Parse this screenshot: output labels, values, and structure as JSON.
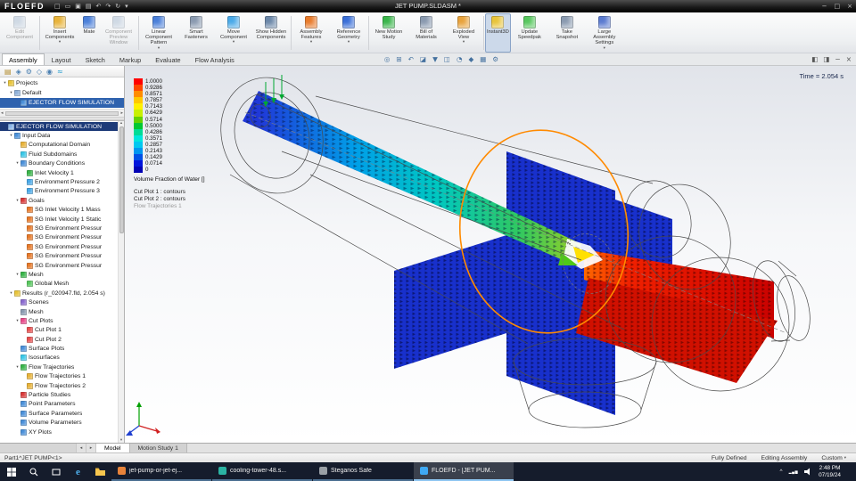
{
  "colors": {
    "accent": "#2f7bd9",
    "legend": [
      "#ff0000",
      "#ff4800",
      "#ff8c00",
      "#ffc800",
      "#fff000",
      "#c8f000",
      "#64d200",
      "#00c832",
      "#00dc96",
      "#00e6dc",
      "#00c8f0",
      "#0096f0",
      "#0050e6",
      "#0014dc",
      "#0000b4"
    ]
  },
  "glyphs": {
    "left": "◂",
    "right": "▸",
    "up": "▴",
    "down": "▾",
    "caret": "▾",
    "chevron_up": "^"
  },
  "titlebar": {
    "logo": "FLOEFD",
    "title": "JET PUMP.SLDASM *",
    "qat": [
      {
        "name": "new-document-icon",
        "glyph": "□"
      },
      {
        "name": "open-icon",
        "glyph": "▭"
      },
      {
        "name": "save-icon",
        "glyph": "▣"
      },
      {
        "name": "print-icon",
        "glyph": "▤"
      },
      {
        "name": "undo-icon",
        "glyph": "↶"
      },
      {
        "name": "redo-icon",
        "glyph": "↷"
      },
      {
        "name": "rebuild-icon",
        "glyph": "↻"
      },
      {
        "name": "options-dropdown-icon",
        "glyph": "▾"
      }
    ],
    "window_controls": [
      {
        "name": "minimize-button",
        "glyph": "−"
      },
      {
        "name": "restore-button",
        "glyph": "□"
      },
      {
        "name": "close-button",
        "glyph": "×"
      }
    ]
  },
  "ribbon": {
    "buttons": [
      {
        "label": "Edit Component",
        "disabled": true,
        "icon_color": "#9fb4cc",
        "group_end": true
      },
      {
        "label": "Insert Components",
        "dropdown": true,
        "icon_color": "#e8b33a"
      },
      {
        "label": "Mate",
        "icon_color": "#4a7fd9"
      },
      {
        "label": "Component Preview Window",
        "disabled": true,
        "icon_color": "#9fb4cc",
        "group_end": true
      },
      {
        "label": "Linear Component Pattern",
        "dropdown": true,
        "icon_color": "#4a7fd9"
      },
      {
        "label": "Smart Fasteners",
        "icon_color": "#8a9ab0"
      },
      {
        "label": "Move Component",
        "dropdown": true,
        "icon_color": "#49a9e8"
      },
      {
        "label": "Show Hidden Components",
        "icon_color": "#6b87a8",
        "group_end": true
      },
      {
        "label": "Assembly Features",
        "dropdown": true,
        "icon_color": "#e87a2a"
      },
      {
        "label": "Reference Geometry",
        "dropdown": true,
        "icon_color": "#3a6fd8",
        "group_end": true
      },
      {
        "label": "New Motion Study",
        "icon_color": "#39b54a"
      },
      {
        "label": "Bill of Materials",
        "icon_color": "#8a9ab0"
      },
      {
        "label": "Exploded View",
        "dropdown": true,
        "icon_color": "#e8a23a",
        "group_end": true
      },
      {
        "label": "Instant3D",
        "active": true,
        "icon_color": "#e8c43a"
      },
      {
        "label": "Update Speedpak",
        "icon_color": "#57c75e"
      },
      {
        "label": "Take Snapshot",
        "icon_color": "#8a9ab0"
      },
      {
        "label": "Large Assembly Settings",
        "dropdown": true,
        "icon_color": "#5a7ad0"
      }
    ]
  },
  "tabs": [
    {
      "label": "Assembly",
      "active": true
    },
    {
      "label": "Layout"
    },
    {
      "label": "Sketch"
    },
    {
      "label": "Markup"
    },
    {
      "label": "Evaluate"
    },
    {
      "label": "Flow Analysis"
    }
  ],
  "headsup": [
    {
      "name": "zoom-fit-icon",
      "glyph": "◎"
    },
    {
      "name": "zoom-area-icon",
      "glyph": "⊞"
    },
    {
      "name": "previous-view-icon",
      "glyph": "↶"
    },
    {
      "name": "section-view-icon",
      "glyph": "◪"
    },
    {
      "name": "view-orientation-icon",
      "glyph": "▼"
    },
    {
      "name": "display-style-icon",
      "glyph": "◫"
    },
    {
      "name": "hide-show-items-icon",
      "glyph": "◔"
    },
    {
      "name": "edit-appearance-icon",
      "glyph": "◆"
    },
    {
      "name": "apply-scene-icon",
      "glyph": "▦"
    },
    {
      "name": "view-settings-icon",
      "glyph": "⚙"
    }
  ],
  "viewport_controls": [
    {
      "name": "toggle-left-pane-icon",
      "glyph": "◧"
    },
    {
      "name": "toggle-right-pane-icon",
      "glyph": "◨"
    },
    {
      "name": "minimize-view-icon",
      "glyph": "−"
    },
    {
      "name": "close-view-icon",
      "glyph": "×"
    }
  ],
  "panel_tabs": [
    {
      "name": "feature-manager-tab",
      "glyph": "▤",
      "color": "#b08828"
    },
    {
      "name": "property-manager-tab",
      "glyph": "◈",
      "color": "#4a7fb0"
    },
    {
      "name": "configuration-manager-tab",
      "glyph": "⚙",
      "color": "#4a7fb0"
    },
    {
      "name": "dimxpert-tab",
      "glyph": "◇",
      "color": "#4a7fb0"
    },
    {
      "name": "display-manager-tab",
      "glyph": "◉",
      "color": "#4a7fb0"
    },
    {
      "name": "flow-simulation-tab",
      "glyph": "≈",
      "color": "#2a9fd0"
    }
  ],
  "project_tree": [
    {
      "label": "Projects",
      "indent": 0,
      "expander": "▾",
      "color": "#e8c43a"
    },
    {
      "label": "Default",
      "indent": 1,
      "expander": "▾",
      "color": "#8fb0d8"
    },
    {
      "label": "EJECTOR FLOW SIMULATION",
      "indent": 2,
      "expander": "",
      "color": "#4a90d9",
      "selected": true
    }
  ],
  "sim_tree": [
    {
      "label": "EJECTOR FLOW SIMULATION",
      "indent": 0,
      "expander": "",
      "color": "#8ab4e8",
      "selected": true
    },
    {
      "label": "Input Data",
      "indent": 1,
      "expander": "▾",
      "color": "#4a90d9"
    },
    {
      "label": "Computational Domain",
      "indent": 2,
      "expander": "",
      "color": "#e8b33a"
    },
    {
      "label": "Fluid Subdomains",
      "indent": 2,
      "expander": "",
      "color": "#39c8e8"
    },
    {
      "label": "Boundary Conditions",
      "indent": 2,
      "expander": "▾",
      "color": "#4a90d9"
    },
    {
      "label": "Inlet Velocity 1",
      "indent": 3,
      "expander": "",
      "color": "#39b54a"
    },
    {
      "label": "Environment Pressure 2",
      "indent": 3,
      "expander": "",
      "color": "#49a9e8"
    },
    {
      "label": "Environment Pressure 3",
      "indent": 3,
      "expander": "",
      "color": "#49a9e8"
    },
    {
      "label": "Goals",
      "indent": 2,
      "expander": "▾",
      "color": "#d93a3a"
    },
    {
      "label": "SG Inlet Velocity 1 Mass",
      "indent": 3,
      "expander": "",
      "color": "#e87a2a"
    },
    {
      "label": "SG Inlet Velocity 1 Static",
      "indent": 3,
      "expander": "",
      "color": "#e87a2a"
    },
    {
      "label": "SG Environment Pressur",
      "indent": 3,
      "expander": "",
      "color": "#e87a2a"
    },
    {
      "label": "SG Environment Pressur",
      "indent": 3,
      "expander": "",
      "color": "#e87a2a"
    },
    {
      "label": "SG Environment Pressur",
      "indent": 3,
      "expander": "",
      "color": "#e87a2a"
    },
    {
      "label": "SG Environment Pressur",
      "indent": 3,
      "expander": "",
      "color": "#e87a2a"
    },
    {
      "label": "SG Environment Pressur",
      "indent": 3,
      "expander": "",
      "color": "#e87a2a"
    },
    {
      "label": "Mesh",
      "indent": 2,
      "expander": "▾",
      "color": "#39b54a"
    },
    {
      "label": "Global Mesh",
      "indent": 3,
      "expander": "",
      "color": "#57c75e"
    },
    {
      "label": "Results (r_020947.fld, 2.054 s)",
      "indent": 1,
      "expander": "▾",
      "color": "#e8c43a"
    },
    {
      "label": "Scenes",
      "indent": 2,
      "expander": "",
      "color": "#8a6ad0"
    },
    {
      "label": "Mesh",
      "indent": 2,
      "expander": "",
      "color": "#8a9ab0"
    },
    {
      "label": "Cut Plots",
      "indent": 2,
      "expander": "▾",
      "color": "#e84a8a"
    },
    {
      "label": "Cut Plot 1",
      "indent": 3,
      "expander": "",
      "color": "#e85050"
    },
    {
      "label": "Cut Plot 2",
      "indent": 3,
      "expander": "",
      "color": "#e85050"
    },
    {
      "label": "Surface Plots",
      "indent": 2,
      "expander": "",
      "color": "#4a90d9"
    },
    {
      "label": "Isosurfaces",
      "indent": 2,
      "expander": "",
      "color": "#39c8e8"
    },
    {
      "label": "Flow Trajectories",
      "indent": 2,
      "expander": "▾",
      "color": "#39b54a"
    },
    {
      "label": "Flow Trajectories 1",
      "indent": 3,
      "expander": "",
      "color": "#e8b33a"
    },
    {
      "label": "Flow Trajectories 2",
      "indent": 3,
      "expander": "",
      "color": "#e8b33a"
    },
    {
      "label": "Particle Studies",
      "indent": 2,
      "expander": "",
      "color": "#d93a3a"
    },
    {
      "label": "Point Parameters",
      "indent": 2,
      "expander": "",
      "color": "#4a90d9"
    },
    {
      "label": "Surface Parameters",
      "indent": 2,
      "expander": "",
      "color": "#4a90d9"
    },
    {
      "label": "Volume Parameters",
      "indent": 2,
      "expander": "",
      "color": "#4a90d9"
    },
    {
      "label": "XY Plots",
      "indent": 2,
      "expander": "",
      "color": "#4a90d9"
    }
  ],
  "viewport": {
    "time_label": "Time = 2.054 s",
    "legend": {
      "title": "Volume Fraction of Water []",
      "values": [
        "1.0000",
        "0.9286",
        "0.8571",
        "0.7857",
        "0.7143",
        "0.6429",
        "0.5714",
        "0.5000",
        "0.4286",
        "0.3571",
        "0.2857",
        "0.2143",
        "0.1429",
        "0.0714",
        "0"
      ],
      "captions": [
        {
          "label": "Cut Plot 1 : contours",
          "muted": false
        },
        {
          "label": "Cut Plot 2 : contours",
          "muted": false
        },
        {
          "label": "Flow Trajectories 1",
          "muted": true
        }
      ]
    }
  },
  "bottom_tabs": [
    {
      "label": "Model",
      "active": true
    },
    {
      "label": "Motion Study 1"
    }
  ],
  "statusbar": {
    "left": "Part1^JET PUMP<1>",
    "items": [
      "Fully Defined",
      "Editing Assembly"
    ],
    "custom": "Custom"
  },
  "taskbar": {
    "quick": [
      {
        "name": "start-button",
        "kind": "windows"
      },
      {
        "name": "search-icon",
        "kind": "search"
      },
      {
        "name": "task-view-icon",
        "kind": "taskview"
      },
      {
        "name": "edge-icon",
        "kind": "edge"
      },
      {
        "name": "file-explorer-icon",
        "kind": "folder"
      }
    ],
    "apps": [
      {
        "label": "jet-pump-or-jet-ej...",
        "color": "#e8833a"
      },
      {
        "label": "cooling-tower-48.s...",
        "color": "#2bb3a3"
      },
      {
        "label": "Steganos Safe",
        "color": "#9aa0a6"
      },
      {
        "label": "FLOEFD - [JET PUM...",
        "color": "#3fa9f5",
        "active": true
      }
    ],
    "tray": {
      "time": "2:48 PM",
      "date": "07/19/24"
    }
  }
}
